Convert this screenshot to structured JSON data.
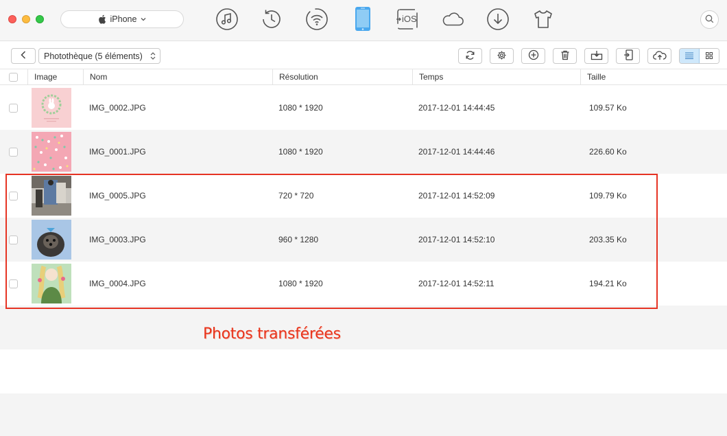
{
  "titlebar": {
    "device_label": "iPhone",
    "top_icons": [
      "music-icon",
      "history-icon",
      "wifi-icon",
      "phone-icon",
      "to-ios-icon",
      "cloud-icon",
      "download-icon",
      "tshirt-icon"
    ],
    "to_ios_label": "iOS"
  },
  "toolbar": {
    "library_label": "Photothèque (5 éléments)",
    "buttons": [
      "refresh-icon",
      "settings-icon",
      "add-icon",
      "trash-icon",
      "export-to-computer-icon",
      "import-to-device-icon",
      "upload-cloud-icon"
    ],
    "views": [
      "list-view-icon",
      "grid-view-icon"
    ],
    "active_view": "list"
  },
  "table": {
    "columns": [
      "Image",
      "Nom",
      "Résolution",
      "Temps",
      "Taille"
    ],
    "rows": [
      {
        "name": "IMG_0002.JPG",
        "resolution": "1080 * 1920",
        "time": "2017-12-01 14:44:45",
        "size": "109.57 Ko"
      },
      {
        "name": "IMG_0001.JPG",
        "resolution": "1080 * 1920",
        "time": "2017-12-01 14:44:46",
        "size": "226.60 Ko"
      },
      {
        "name": "IMG_0005.JPG",
        "resolution": "720 * 720",
        "time": "2017-12-01 14:52:09",
        "size": "109.79 Ko"
      },
      {
        "name": "IMG_0003.JPG",
        "resolution": "960 * 1280",
        "time": "2017-12-01 14:52:10",
        "size": "203.35 Ko"
      },
      {
        "name": "IMG_0004.JPG",
        "resolution": "1080 * 1920",
        "time": "2017-12-01 14:52:11",
        "size": "194.21 Ko"
      }
    ]
  },
  "annotation": {
    "text": "Photos transférées",
    "color": "#e8341c"
  },
  "colors": {
    "accent": "#4aa8ee",
    "highlight": "#e63323"
  }
}
